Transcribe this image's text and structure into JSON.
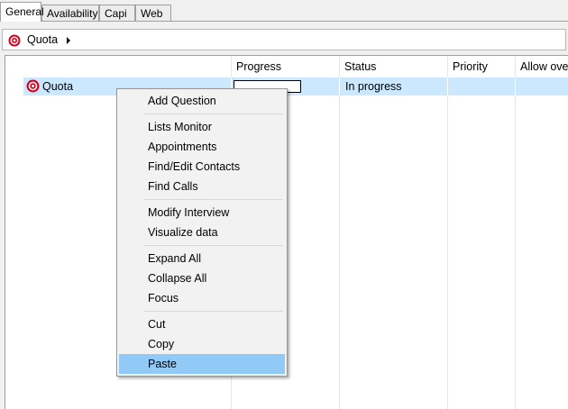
{
  "tabs": [
    {
      "label": "General",
      "active": true
    },
    {
      "label": "Availability",
      "active": false
    },
    {
      "label": "Capi",
      "active": false
    },
    {
      "label": "Web",
      "active": false
    }
  ],
  "breadcrumb": {
    "label": "Quota",
    "icon": "target-icon"
  },
  "grid": {
    "columns": [
      "Progress",
      "Status",
      "Priority",
      "Allow ove"
    ],
    "rows": [
      {
        "name": "Quota",
        "icon": "target-icon",
        "progress": "",
        "status": "In progress",
        "priority": "",
        "allow": ""
      }
    ]
  },
  "context_menu": {
    "groups": [
      [
        "Add Question"
      ],
      [
        "Lists Monitor",
        "Appointments",
        "Find/Edit Contacts",
        "Find Calls"
      ],
      [
        "Modify Interview",
        "Visualize data"
      ],
      [
        "Expand All",
        "Collapse All",
        "Focus"
      ],
      [
        "Cut",
        "Copy",
        "Paste"
      ]
    ],
    "highlighted": "Paste"
  },
  "colors": {
    "selection": "#cce8ff",
    "menu_hover": "#91c9f7",
    "icon_red": "#d8001c"
  }
}
